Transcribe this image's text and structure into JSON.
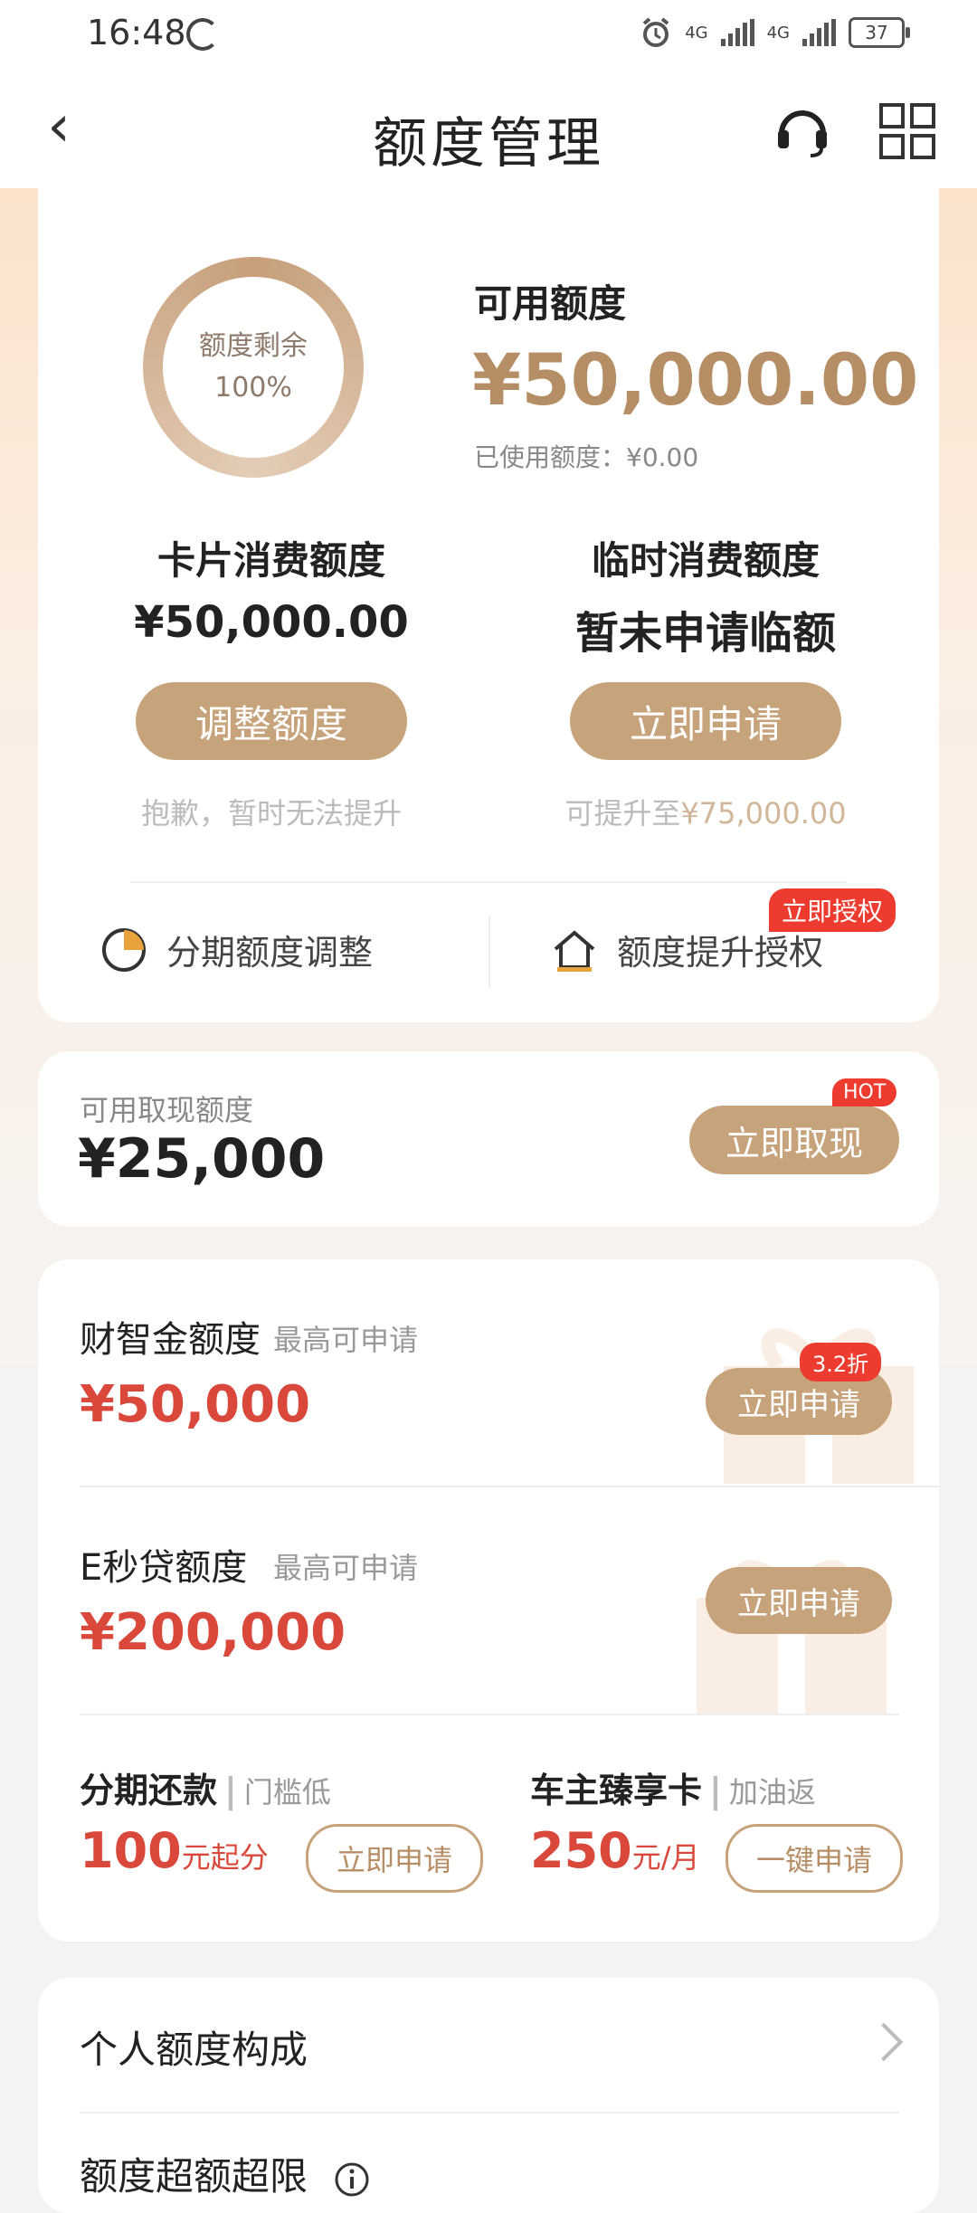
{
  "status_bar": {
    "time": "16:48",
    "network1": "4G",
    "network2": "4G",
    "battery": "37"
  },
  "nav": {
    "title": "额度管理"
  },
  "credit_card": {
    "ring_label": "额度剩余",
    "ring_percent": "100%",
    "ring_fill_fraction": 1.0,
    "available_label": "可用额度",
    "available_amount": "¥50,000.00",
    "used_label": "已使用额度：¥0.00",
    "card_limit": {
      "title": "卡片消费额度",
      "value": "¥50,000.00",
      "button": "调整额度",
      "note": "抱歉，暂时无法提升"
    },
    "temp_limit": {
      "title": "临时消费额度",
      "value": "暂未申请临额",
      "button": "立即申请",
      "note_prefix": "可提升至",
      "note_amount": "¥75,000.00"
    },
    "links": {
      "installment": "分期额度调整",
      "authorize": "额度提升授权",
      "authorize_tag": "立即授权"
    }
  },
  "cash_card": {
    "label": "可用取现额度",
    "amount": "¥25,000",
    "button": "立即取现",
    "tag": "HOT"
  },
  "products": {
    "caizhijin": {
      "title": "财智金额度",
      "sub": "最高可申请",
      "amount": "¥50,000",
      "button": "立即申请",
      "tag": "3.2折"
    },
    "emiao": {
      "title": "E秒贷额度",
      "sub": "最高可申请",
      "amount": "¥200,000",
      "button": "立即申请"
    },
    "installment": {
      "title": "分期还款",
      "sub": "门槛低",
      "num": "100",
      "unit": "元起分",
      "button": "立即申请"
    },
    "car_card": {
      "title": "车主臻享卡",
      "sub": "加油返",
      "num": "250",
      "unit": "元/月",
      "button": "一键申请"
    }
  },
  "bottom_card": {
    "row1": "个人额度构成",
    "row2": "额度超额超限"
  }
}
